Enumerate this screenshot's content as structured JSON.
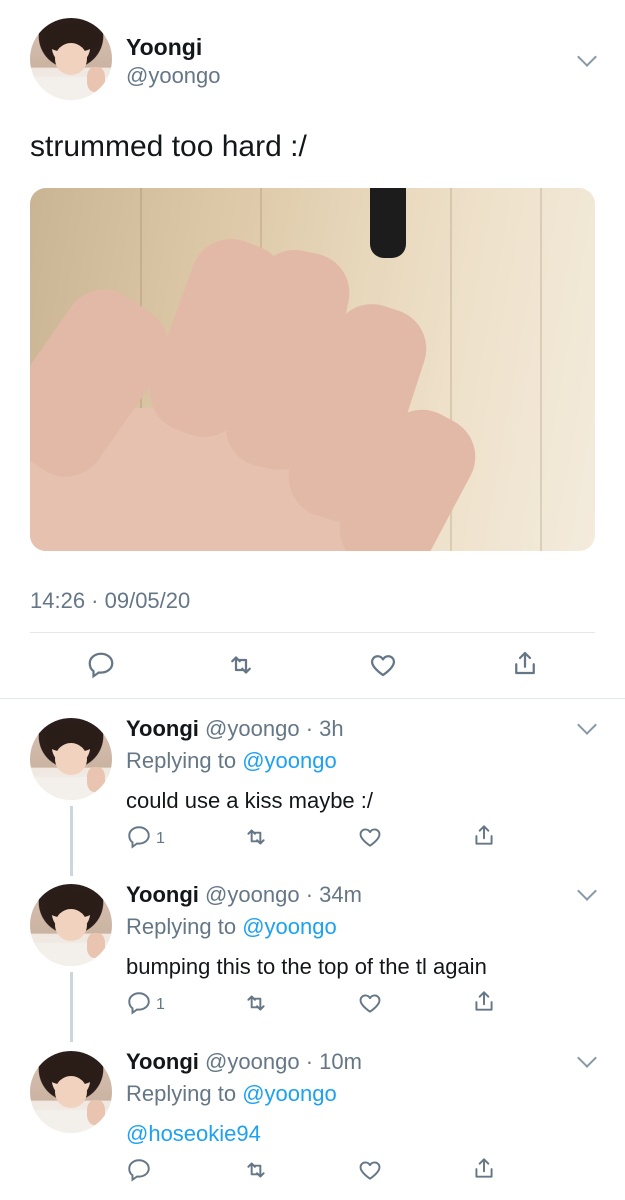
{
  "main_tweet": {
    "name": "Yoongi",
    "handle": "@yoongo",
    "text": "strummed too hard :/",
    "timestamp": "14:26 · 09/05/20",
    "actions": [
      "reply-icon",
      "retweet-icon",
      "like-icon",
      "share-icon"
    ]
  },
  "replies": [
    {
      "name": "Yoongi",
      "handle": "@yoongo",
      "time": "· 3h",
      "replying_prefix": "Replying to",
      "replying_to": "@yoongo",
      "text": "could use a kiss maybe :/",
      "reply_count": "1"
    },
    {
      "name": "Yoongi",
      "handle": "@yoongo",
      "time": "· 34m",
      "replying_prefix": "Replying to",
      "replying_to": "@yoongo",
      "text": "bumping this to the top of the tl again",
      "reply_count": "1"
    },
    {
      "name": "Yoongi",
      "handle": "@yoongo",
      "time": "· 10m",
      "replying_prefix": "Replying to",
      "replying_to": "@yoongo",
      "text": "@hoseokie94",
      "reply_count": ""
    }
  ],
  "colors": {
    "accent": "#1da1f2",
    "secondary_text": "#657786",
    "divider": "#e1e8ed",
    "thread_line": "#ccd6dd"
  }
}
